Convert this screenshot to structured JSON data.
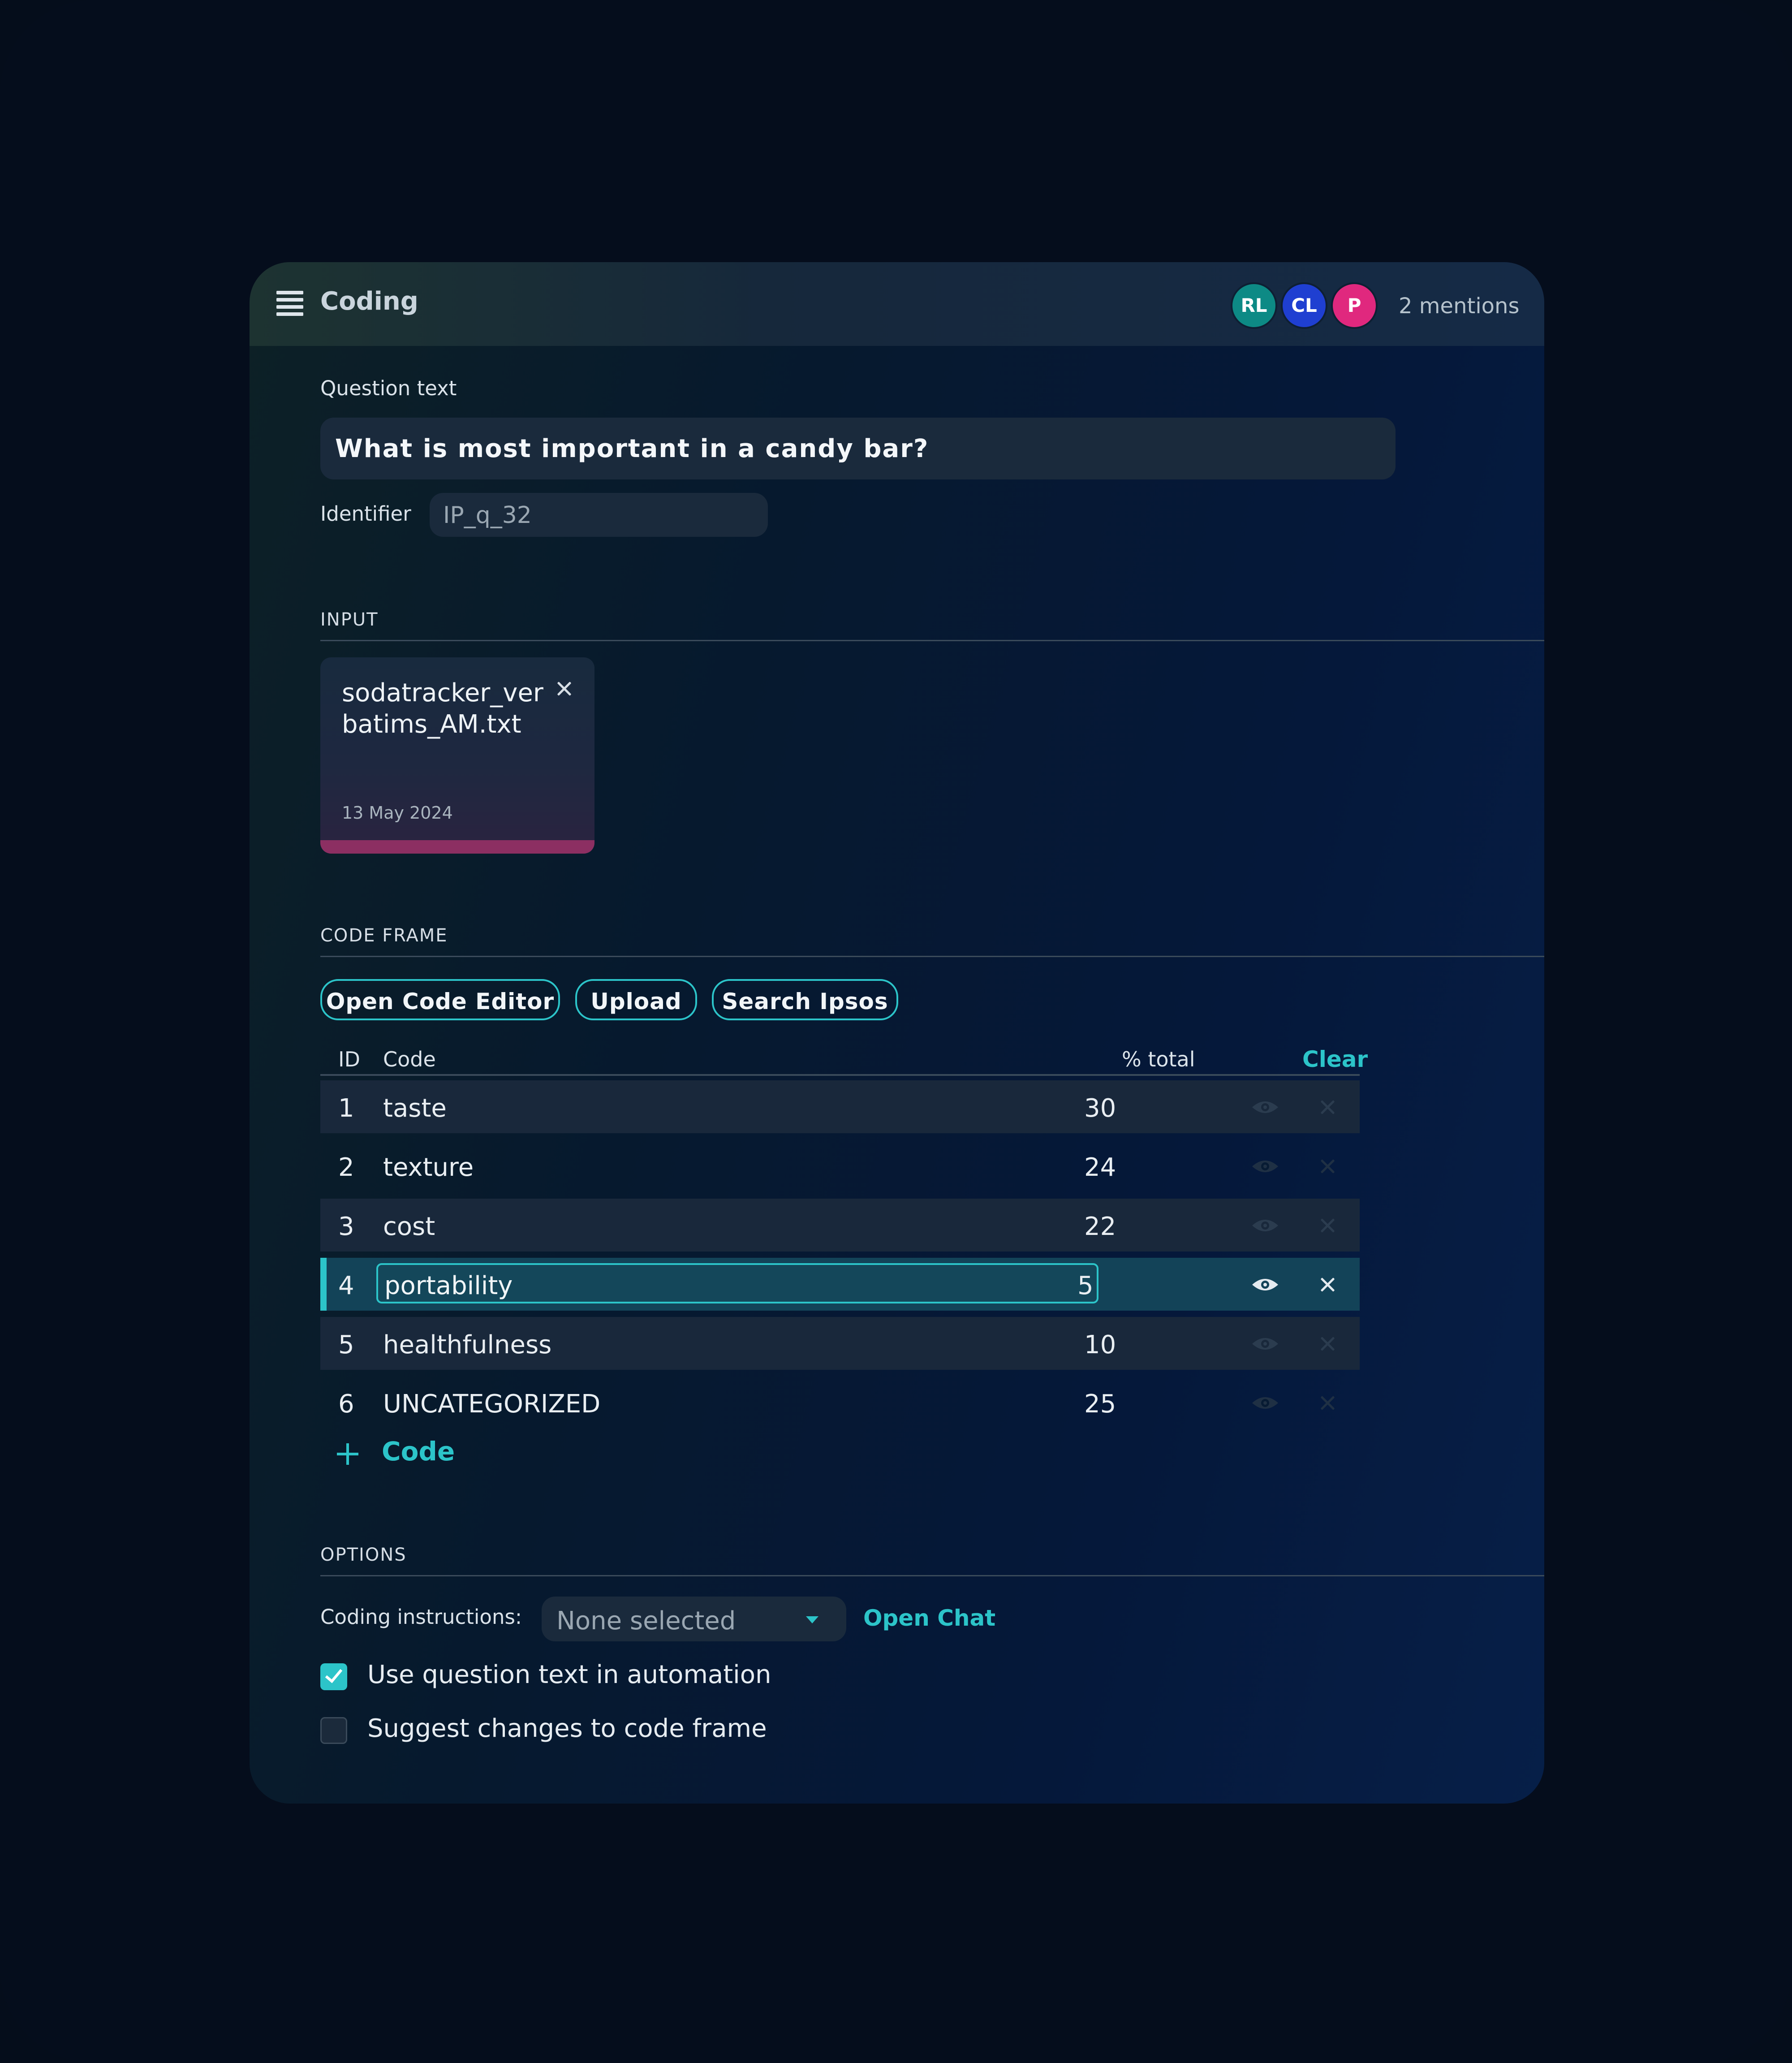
{
  "header": {
    "title": "Coding",
    "mentions": "2 mentions",
    "avatars": [
      {
        "initials": "RL",
        "color": "#0d8a85"
      },
      {
        "initials": "CL",
        "color": "#1f3fd1"
      },
      {
        "initials": "P",
        "color": "#e0287e"
      }
    ]
  },
  "question": {
    "label": "Question text",
    "text": "What is most important in a candy bar?",
    "identifier_label": "Identifier",
    "identifier_value": "IP_q_32"
  },
  "input": {
    "section_title": "INPUT",
    "file_name": "sodatracker_verbatims_AM.txt",
    "file_date": "13 May 2024"
  },
  "code_frame": {
    "section_title": "CODE FRAME",
    "buttons": {
      "open_code_editor": "Open Code Editor",
      "upload": "Upload",
      "search_ipsos": "Search Ipsos"
    },
    "headers": {
      "id": "ID",
      "code": "Code",
      "pct": "% total",
      "clear": "Clear"
    },
    "rows": [
      {
        "id": "1",
        "code": "taste",
        "pct": "30"
      },
      {
        "id": "2",
        "code": "texture",
        "pct": "24"
      },
      {
        "id": "3",
        "code": "cost",
        "pct": "22"
      },
      {
        "id": "4",
        "code": "portability",
        "pct": "5"
      },
      {
        "id": "5",
        "code": "healthfulness",
        "pct": "10"
      },
      {
        "id": "6",
        "code": "UNCATEGORIZED",
        "pct": "25"
      }
    ],
    "add_code_label": "Code"
  },
  "options": {
    "section_title": "OPTIONS",
    "instructions_label": "Coding instructions:",
    "instructions_value": "None selected",
    "open_chat": "Open Chat",
    "use_question_text": {
      "label": "Use question text in automation",
      "checked": true
    },
    "suggest_changes": {
      "label": "Suggest changes to code frame",
      "checked": false
    }
  },
  "colors": {
    "accent": "#2cc4c9",
    "file_accent": "#8c2f62",
    "selected_row": "#134358"
  },
  "icons": [
    "menu-icon",
    "close-icon",
    "eye-icon",
    "plus-icon",
    "chevron-down-icon",
    "check-icon"
  ]
}
